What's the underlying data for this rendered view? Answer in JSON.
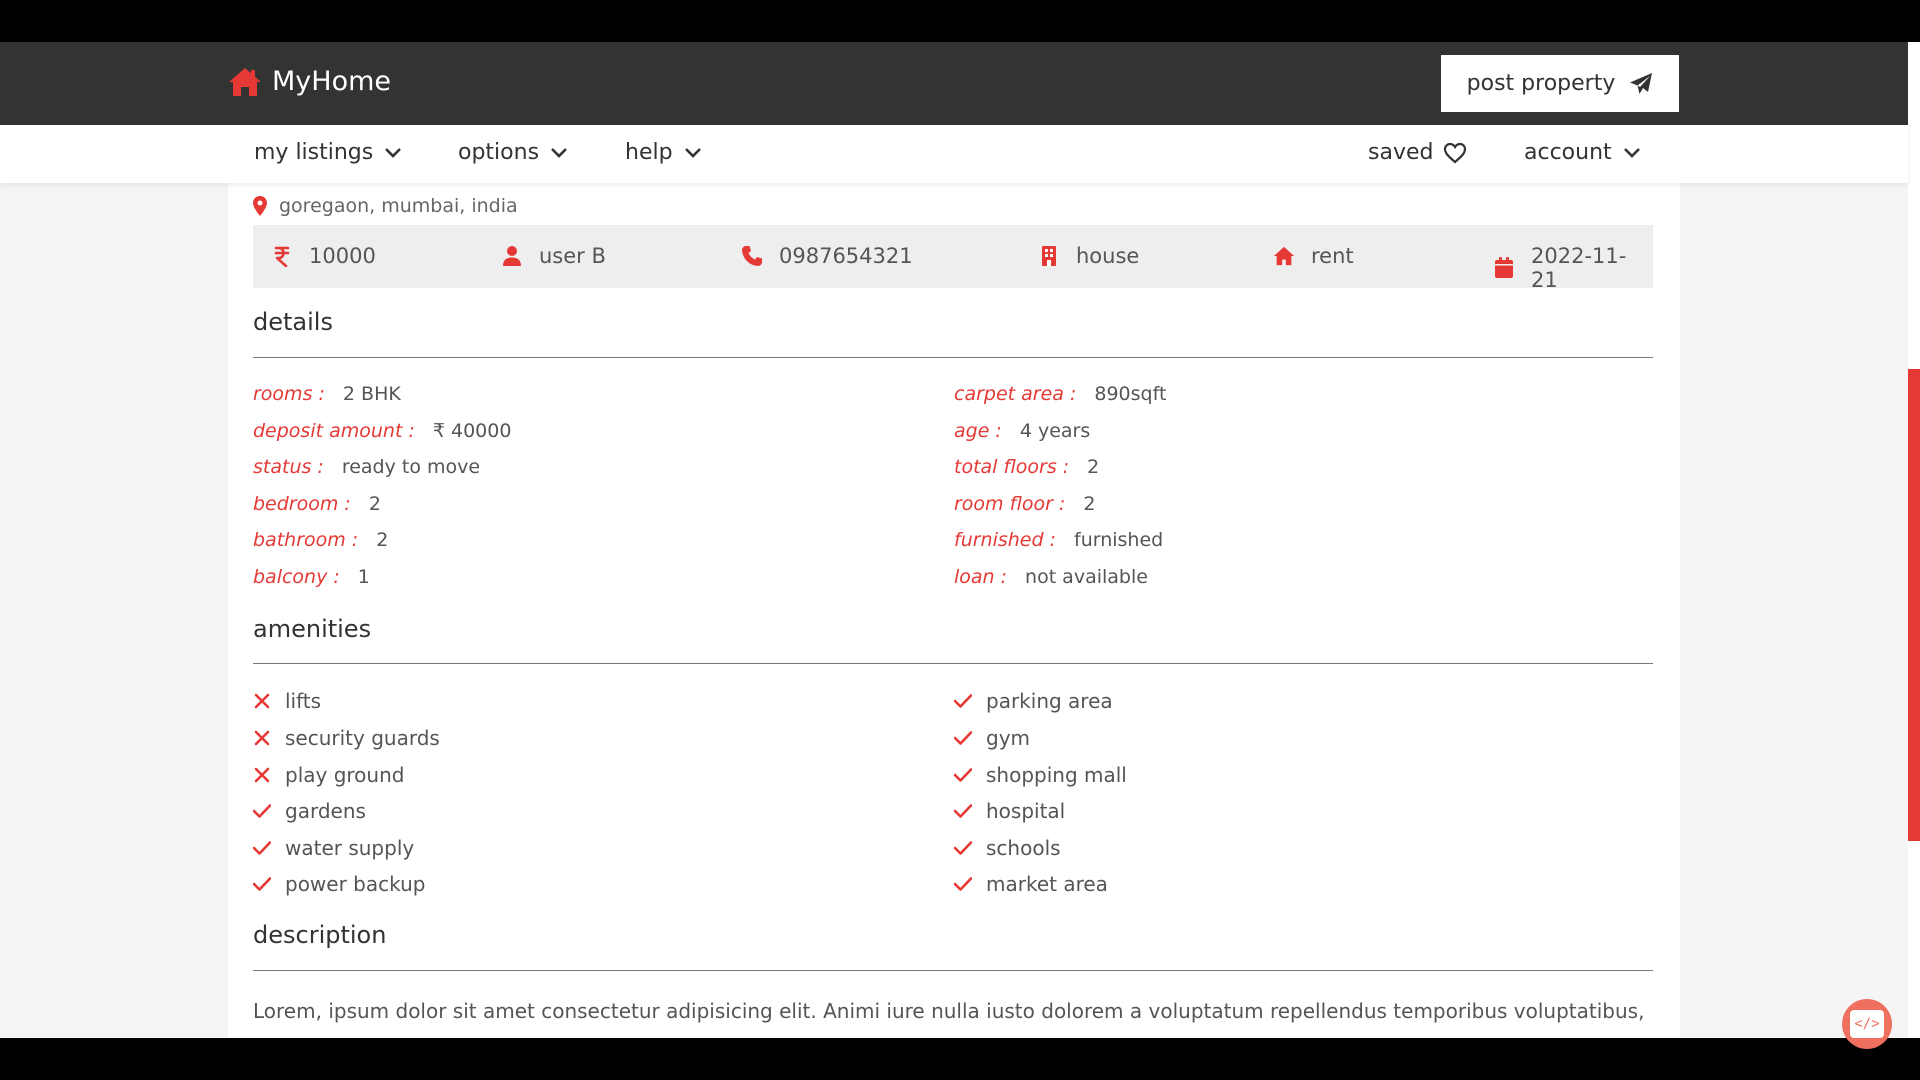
{
  "brand": {
    "name": "MyHome",
    "accent": "#e53935",
    "header_bg": "#333333"
  },
  "header": {
    "post_label": "post property"
  },
  "nav": {
    "my_listings": "my listings",
    "options": "options",
    "help": "help",
    "saved": "saved",
    "account": "account"
  },
  "property": {
    "location": "goregaon, mumbai, india",
    "price": "10000",
    "owner": "user B",
    "phone": "0987654321",
    "type": "house",
    "purpose": "rent",
    "date": "2022-11-21"
  },
  "details": {
    "title": "details",
    "left": [
      {
        "key": "rooms :",
        "value": "2 BHK"
      },
      {
        "key": "deposit amount :",
        "value": "₹ 40000"
      },
      {
        "key": "status :",
        "value": "ready to move"
      },
      {
        "key": "bedroom :",
        "value": "2"
      },
      {
        "key": "bathroom :",
        "value": "2"
      },
      {
        "key": "balcony :",
        "value": "1"
      }
    ],
    "right": [
      {
        "key": "carpet area :",
        "value": "890sqft"
      },
      {
        "key": "age :",
        "value": "4 years"
      },
      {
        "key": "total floors :",
        "value": "2"
      },
      {
        "key": "room floor :",
        "value": "2"
      },
      {
        "key": "furnished :",
        "value": "furnished"
      },
      {
        "key": "loan :",
        "value": "not available"
      }
    ]
  },
  "amenities": {
    "title": "amenities",
    "left": [
      {
        "label": "lifts",
        "available": false
      },
      {
        "label": "security guards",
        "available": false
      },
      {
        "label": "play ground",
        "available": false
      },
      {
        "label": "gardens",
        "available": true
      },
      {
        "label": "water supply",
        "available": true
      },
      {
        "label": "power backup",
        "available": true
      }
    ],
    "right": [
      {
        "label": "parking area",
        "available": true
      },
      {
        "label": "gym",
        "available": true
      },
      {
        "label": "shopping mall",
        "available": true
      },
      {
        "label": "hospital",
        "available": true
      },
      {
        "label": "schools",
        "available": true
      },
      {
        "label": "market area",
        "available": true
      }
    ]
  },
  "description": {
    "title": "description",
    "text": "Lorem, ipsum dolor sit amet consectetur adipisicing elit. Animi iure nulla iusto dolorem a voluptatum repellendus temporibus voluptatibus,"
  },
  "fab": {
    "label": "</>"
  }
}
